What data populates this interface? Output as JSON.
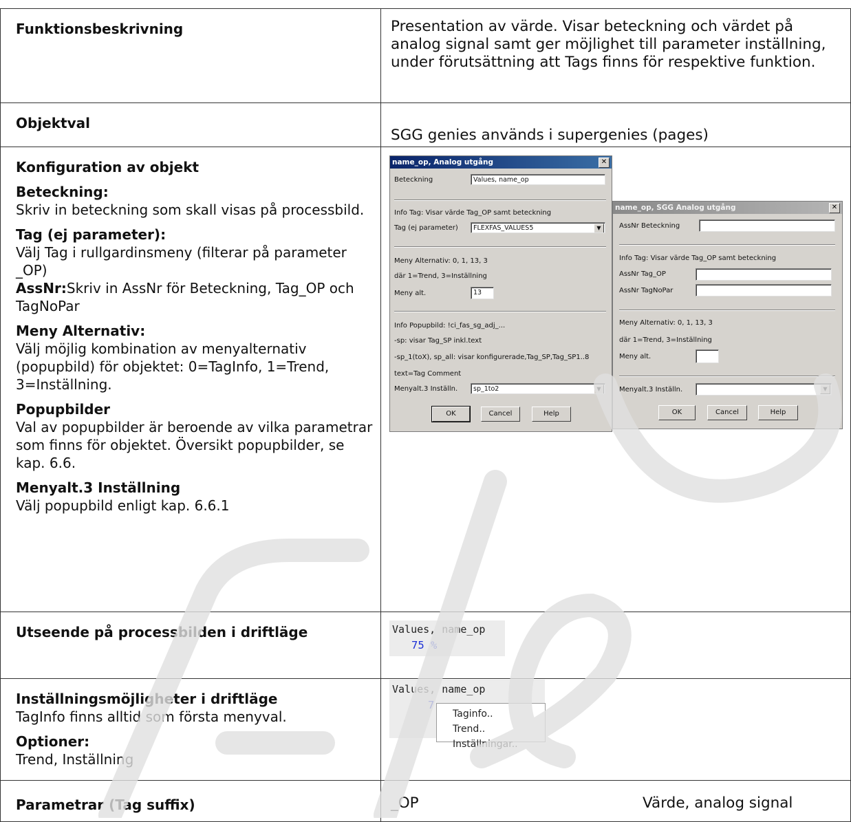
{
  "table": {
    "row1": {
      "heading": "Funktionsbeskrivning",
      "text": "Presentation av värde.  Visar beteckning och värdet på analog signal samt ger möjlighet till parameter inställning, under förutsättning att Tags finns för respektive funktion."
    },
    "row2": {
      "heading": "Objektval",
      "text": "SGG genies används i supergenies (pages)"
    },
    "row3": {
      "heading": "Konfiguration av objekt",
      "sections": [
        {
          "title": "Beteckning:",
          "text": "Skriv in beteckning som skall visas på processbild."
        },
        {
          "title": "Tag (ej parameter):",
          "text": "Välj Tag i rullgardinsmeny (filterar på parameter _OP)",
          "extra_bold": "AssNr:",
          "extra_text": "Skriv in AssNr för Beteckning, Tag_OP och TagNoPar"
        },
        {
          "title": "Meny Alternativ:",
          "text": "Välj möjlig kombination av menyalternativ (popupbild) för objektet: 0=TagInfo, 1=Trend, 3=Inställning."
        },
        {
          "title": "Popupbilder",
          "text": "Val av popupbilder är beroende av vilka parametrar som finns för objektet. Översikt popupbilder, se kap. 6.6."
        },
        {
          "title": "Menyalt.3 Inställning",
          "text": "Välj popupbild enligt kap. 6.6.1"
        }
      ]
    },
    "row4": {
      "heading": "Utseende på processbilden i driftläge"
    },
    "row5": {
      "heading": "Inställningsmöjligheter i driftläge",
      "text": "TagInfo finns alltid som första menyval.",
      "opt_title": "Optioner:",
      "opt_text": "Trend, Inställning"
    },
    "row6": {
      "heading": "Parametrar (Tag suffix)",
      "suffix": "_OP",
      "desc": "Värde, analog signal"
    }
  },
  "dialog1": {
    "title": "name_op, Analog utgång",
    "close": "✕",
    "beteckning_label": "Beteckning",
    "beteckning_value": "Values, name_op",
    "info_tag": "Info Tag: Visar värde Tag_OP samt beteckning",
    "tag_label": "Tag (ej parameter)",
    "tag_value": "FLEXFAS_VALUES5",
    "meny_alt_text": "Meny Alternativ: 0, 1, 13, 3",
    "dar_text": "där 1=Trend, 3=Inställning",
    "meny_alt_label": "Meny alt.",
    "meny_alt_value": "13",
    "info_popup": "Info Popupbild: !ci_fas_sg_adj_...",
    "sp_line": "-sp: visar Tag_SP inkl.text",
    "sp1_line": "-sp_1(toX), sp_all: visar konfigurerade,Tag_SP,Tag_SP1..8",
    "text_line": " text=Tag Comment",
    "menyalt3_label": "Menyalt.3 Inställn.",
    "menyalt3_value": "sp_1to2",
    "ok": "OK",
    "cancel": "Cancel",
    "help": "Help"
  },
  "dialog2": {
    "title": "name_op, SGG Analog utgång",
    "close": "✕",
    "assnr_label": "AssNr Beteckning",
    "info_tag": "Info Tag: Visar värde Tag_OP samt beteckning",
    "tag_op_label": "AssNr Tag_OP",
    "tagnopar_label": "AssNr TagNoPar",
    "meny_alt_text": "Meny Alternativ: 0, 1, 13, 3",
    "dar_text": "där 1=Trend, 3=Inställning",
    "meny_alt_label": "Meny alt.",
    "menyalt3_label": "Menyalt.3 Inställn.",
    "ok": "OK",
    "cancel": "Cancel",
    "help": "Help"
  },
  "preview1": {
    "name": "Values, name_op",
    "value": "75 %"
  },
  "preview2": {
    "name": "Values, name_op",
    "value": "7",
    "menu": [
      "Taginfo..",
      "Trend..",
      "Inställningar.."
    ]
  },
  "dropdown_arrow": "▼"
}
